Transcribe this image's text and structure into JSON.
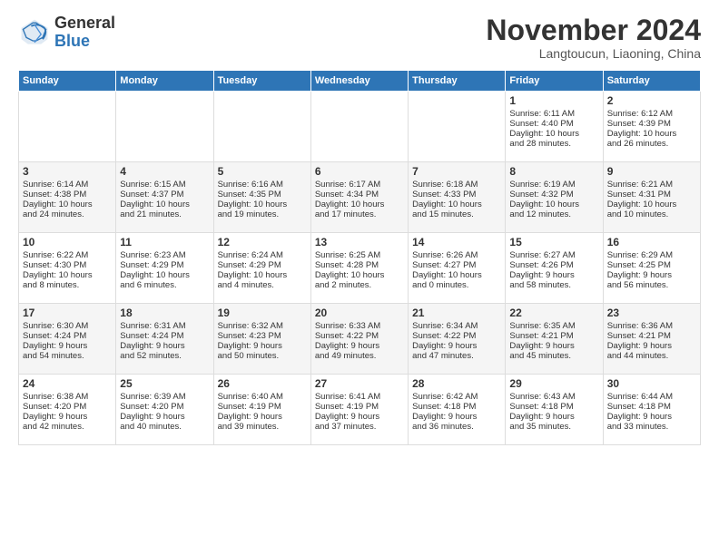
{
  "header": {
    "logo_line1": "General",
    "logo_line2": "Blue",
    "main_title": "November 2024",
    "subtitle": "Langtoucun, Liaoning, China"
  },
  "weekdays": [
    "Sunday",
    "Monday",
    "Tuesday",
    "Wednesday",
    "Thursday",
    "Friday",
    "Saturday"
  ],
  "weeks": [
    [
      {
        "day": "",
        "info": ""
      },
      {
        "day": "",
        "info": ""
      },
      {
        "day": "",
        "info": ""
      },
      {
        "day": "",
        "info": ""
      },
      {
        "day": "",
        "info": ""
      },
      {
        "day": "1",
        "info": "Sunrise: 6:11 AM\nSunset: 4:40 PM\nDaylight: 10 hours\nand 28 minutes."
      },
      {
        "day": "2",
        "info": "Sunrise: 6:12 AM\nSunset: 4:39 PM\nDaylight: 10 hours\nand 26 minutes."
      }
    ],
    [
      {
        "day": "3",
        "info": "Sunrise: 6:14 AM\nSunset: 4:38 PM\nDaylight: 10 hours\nand 24 minutes."
      },
      {
        "day": "4",
        "info": "Sunrise: 6:15 AM\nSunset: 4:37 PM\nDaylight: 10 hours\nand 21 minutes."
      },
      {
        "day": "5",
        "info": "Sunrise: 6:16 AM\nSunset: 4:35 PM\nDaylight: 10 hours\nand 19 minutes."
      },
      {
        "day": "6",
        "info": "Sunrise: 6:17 AM\nSunset: 4:34 PM\nDaylight: 10 hours\nand 17 minutes."
      },
      {
        "day": "7",
        "info": "Sunrise: 6:18 AM\nSunset: 4:33 PM\nDaylight: 10 hours\nand 15 minutes."
      },
      {
        "day": "8",
        "info": "Sunrise: 6:19 AM\nSunset: 4:32 PM\nDaylight: 10 hours\nand 12 minutes."
      },
      {
        "day": "9",
        "info": "Sunrise: 6:21 AM\nSunset: 4:31 PM\nDaylight: 10 hours\nand 10 minutes."
      }
    ],
    [
      {
        "day": "10",
        "info": "Sunrise: 6:22 AM\nSunset: 4:30 PM\nDaylight: 10 hours\nand 8 minutes."
      },
      {
        "day": "11",
        "info": "Sunrise: 6:23 AM\nSunset: 4:29 PM\nDaylight: 10 hours\nand 6 minutes."
      },
      {
        "day": "12",
        "info": "Sunrise: 6:24 AM\nSunset: 4:29 PM\nDaylight: 10 hours\nand 4 minutes."
      },
      {
        "day": "13",
        "info": "Sunrise: 6:25 AM\nSunset: 4:28 PM\nDaylight: 10 hours\nand 2 minutes."
      },
      {
        "day": "14",
        "info": "Sunrise: 6:26 AM\nSunset: 4:27 PM\nDaylight: 10 hours\nand 0 minutes."
      },
      {
        "day": "15",
        "info": "Sunrise: 6:27 AM\nSunset: 4:26 PM\nDaylight: 9 hours\nand 58 minutes."
      },
      {
        "day": "16",
        "info": "Sunrise: 6:29 AM\nSunset: 4:25 PM\nDaylight: 9 hours\nand 56 minutes."
      }
    ],
    [
      {
        "day": "17",
        "info": "Sunrise: 6:30 AM\nSunset: 4:24 PM\nDaylight: 9 hours\nand 54 minutes."
      },
      {
        "day": "18",
        "info": "Sunrise: 6:31 AM\nSunset: 4:24 PM\nDaylight: 9 hours\nand 52 minutes."
      },
      {
        "day": "19",
        "info": "Sunrise: 6:32 AM\nSunset: 4:23 PM\nDaylight: 9 hours\nand 50 minutes."
      },
      {
        "day": "20",
        "info": "Sunrise: 6:33 AM\nSunset: 4:22 PM\nDaylight: 9 hours\nand 49 minutes."
      },
      {
        "day": "21",
        "info": "Sunrise: 6:34 AM\nSunset: 4:22 PM\nDaylight: 9 hours\nand 47 minutes."
      },
      {
        "day": "22",
        "info": "Sunrise: 6:35 AM\nSunset: 4:21 PM\nDaylight: 9 hours\nand 45 minutes."
      },
      {
        "day": "23",
        "info": "Sunrise: 6:36 AM\nSunset: 4:21 PM\nDaylight: 9 hours\nand 44 minutes."
      }
    ],
    [
      {
        "day": "24",
        "info": "Sunrise: 6:38 AM\nSunset: 4:20 PM\nDaylight: 9 hours\nand 42 minutes."
      },
      {
        "day": "25",
        "info": "Sunrise: 6:39 AM\nSunset: 4:20 PM\nDaylight: 9 hours\nand 40 minutes."
      },
      {
        "day": "26",
        "info": "Sunrise: 6:40 AM\nSunset: 4:19 PM\nDaylight: 9 hours\nand 39 minutes."
      },
      {
        "day": "27",
        "info": "Sunrise: 6:41 AM\nSunset: 4:19 PM\nDaylight: 9 hours\nand 37 minutes."
      },
      {
        "day": "28",
        "info": "Sunrise: 6:42 AM\nSunset: 4:18 PM\nDaylight: 9 hours\nand 36 minutes."
      },
      {
        "day": "29",
        "info": "Sunrise: 6:43 AM\nSunset: 4:18 PM\nDaylight: 9 hours\nand 35 minutes."
      },
      {
        "day": "30",
        "info": "Sunrise: 6:44 AM\nSunset: 4:18 PM\nDaylight: 9 hours\nand 33 minutes."
      }
    ]
  ]
}
